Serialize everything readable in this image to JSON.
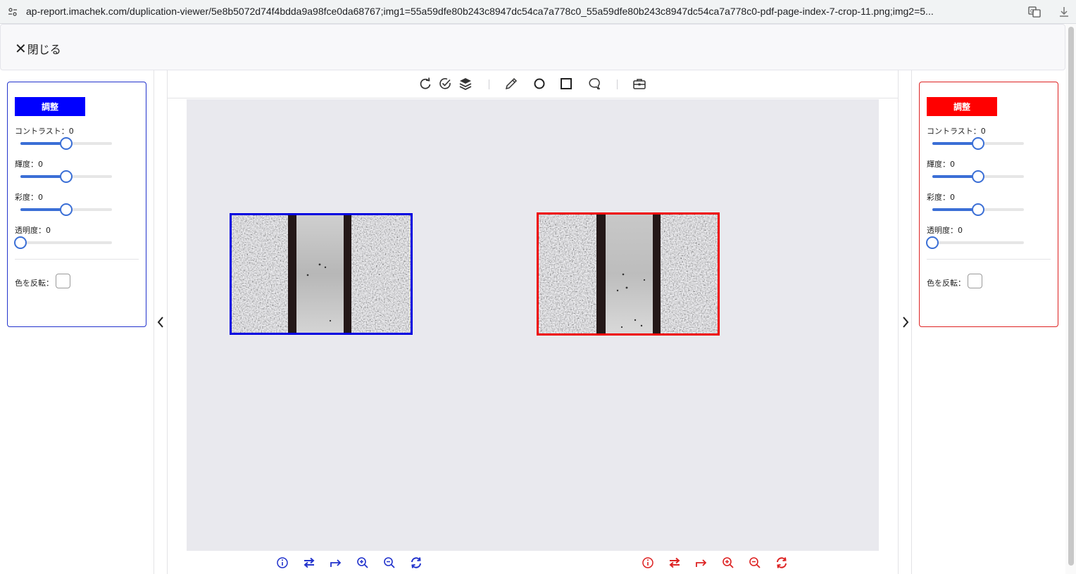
{
  "browser": {
    "url": "ap-report.imachek.com/duplication-viewer/5e8b5072d74f4bdda9a98fce0da68767;img1=55a59dfe80b243c8947dc54ca7a778c0_55a59dfe80b243c8947dc54ca7a778c0-pdf-page-index-7-crop-11.png;img2=5..."
  },
  "header": {
    "close_label": "閉じる",
    "close_glyph": "✕"
  },
  "left_panel": {
    "accent": "#0000ff",
    "adjust_label": "調整",
    "contrast_label": "コントラスト：0",
    "brightness_label": "輝度：0",
    "saturation_label": "彩度：0",
    "opacity_label": "透明度：0",
    "invert_label": "色を反転：",
    "values": {
      "contrast": 0.5,
      "brightness": 0.5,
      "saturation": 0.5,
      "opacity": 0.0
    }
  },
  "right_panel": {
    "accent": "#ff0000",
    "adjust_label": "調整",
    "contrast_label": "コントラスト：0",
    "brightness_label": "輝度：0",
    "saturation_label": "彩度：0",
    "opacity_label": "透明度：0",
    "invert_label": "色を反転：",
    "values": {
      "contrast": 0.5,
      "brightness": 0.5,
      "saturation": 0.5,
      "opacity": 0.0
    }
  },
  "toolbar": {
    "icons": [
      "rotate-icon",
      "check-circle-icon",
      "layers-icon",
      "pencil-icon",
      "circle-icon",
      "square-icon",
      "comment-icon",
      "briefcase-icon"
    ]
  },
  "bottom_toolbar": {
    "icons": [
      "info-icon",
      "swap-icon",
      "share-icon",
      "zoom-in-icon",
      "zoom-out-icon",
      "reset-icon"
    ],
    "left_color": "#2233cc",
    "right_color": "#dd2222"
  }
}
